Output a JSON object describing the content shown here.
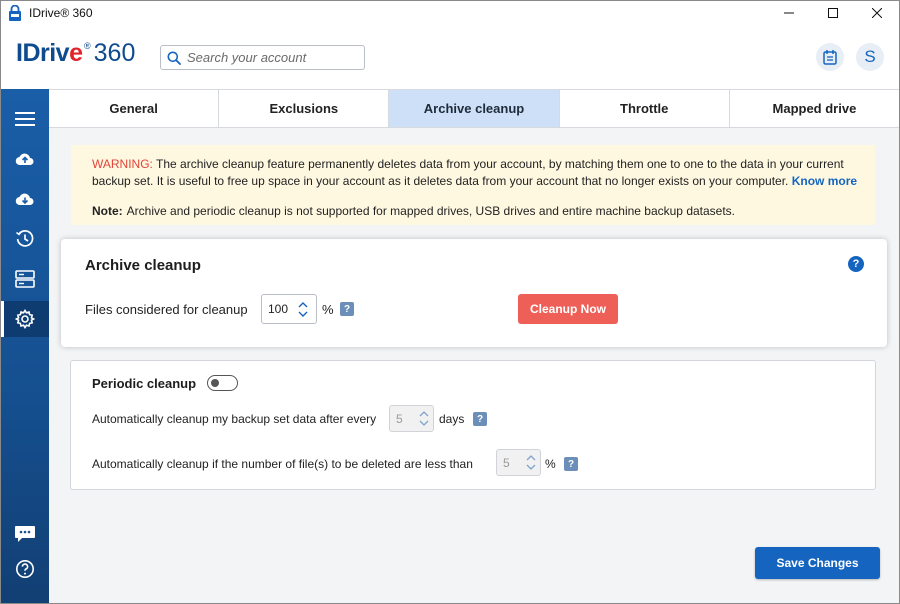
{
  "window": {
    "title": "IDrive® 360",
    "controls": [
      "minimize",
      "maximize",
      "close"
    ]
  },
  "header": {
    "logo": {
      "brand": "IDriv",
      "brand_e": "e",
      "reg": "®",
      "suffix": "360"
    },
    "search": {
      "placeholder": "Search your account",
      "value": ""
    },
    "calendar_icon": "calendar-icon",
    "user_initial": "S"
  },
  "sidebar": {
    "items": [
      {
        "name": "menu",
        "icon": "hamburger-icon",
        "active": false
      },
      {
        "name": "backup",
        "icon": "cloud-upload-icon",
        "active": false
      },
      {
        "name": "restore",
        "icon": "cloud-download-icon",
        "active": false
      },
      {
        "name": "history",
        "icon": "clock-history-icon",
        "active": false
      },
      {
        "name": "devices",
        "icon": "server-icon",
        "active": false
      },
      {
        "name": "settings",
        "icon": "gear-icon",
        "active": true
      },
      {
        "name": "chat",
        "icon": "chat-icon",
        "active": false
      },
      {
        "name": "help",
        "icon": "help-circle-icon",
        "active": false
      }
    ]
  },
  "tabs": [
    {
      "label": "General",
      "active": false
    },
    {
      "label": "Exclusions",
      "active": false
    },
    {
      "label": "Archive cleanup",
      "active": true
    },
    {
      "label": "Throttle",
      "active": false
    },
    {
      "label": "Mapped drive",
      "active": false
    }
  ],
  "warning": {
    "label": "WARNING:",
    "text": " The archive cleanup feature permanently deletes data from your account, by matching them one to one to the data in your current backup set. It is useful to free up space in your account as it deletes data from your account that no longer exists on your computer. ",
    "link": "Know more",
    "note_label": "Note:",
    "note_text": "Archive and periodic cleanup is not supported for mapped drives, USB drives and entire machine backup datasets."
  },
  "archive_cleanup": {
    "title": "Archive cleanup",
    "help": "?",
    "files_label": "Files considered for cleanup",
    "files_value": "100",
    "unit": "%",
    "qmark": "?",
    "button": "Cleanup Now"
  },
  "periodic_cleanup": {
    "title": "Periodic cleanup",
    "enabled": false,
    "row1_label": "Automatically cleanup my backup set data after every",
    "row1_value": "5",
    "row1_unit": "days",
    "row2_label": "Automatically cleanup if the number of file(s) to be deleted  are less than",
    "row2_value": "5",
    "row2_unit": "%",
    "qmark": "?"
  },
  "footer": {
    "save_label": "Save Changes"
  },
  "colors": {
    "brand_blue": "#1565c0",
    "sidebar": "#1a5ea8",
    "active_tab": "#cde0f7",
    "warning_bg": "#fff8e1",
    "warning_label": "#e2443a",
    "cleanup_button": "#ee5f57"
  }
}
